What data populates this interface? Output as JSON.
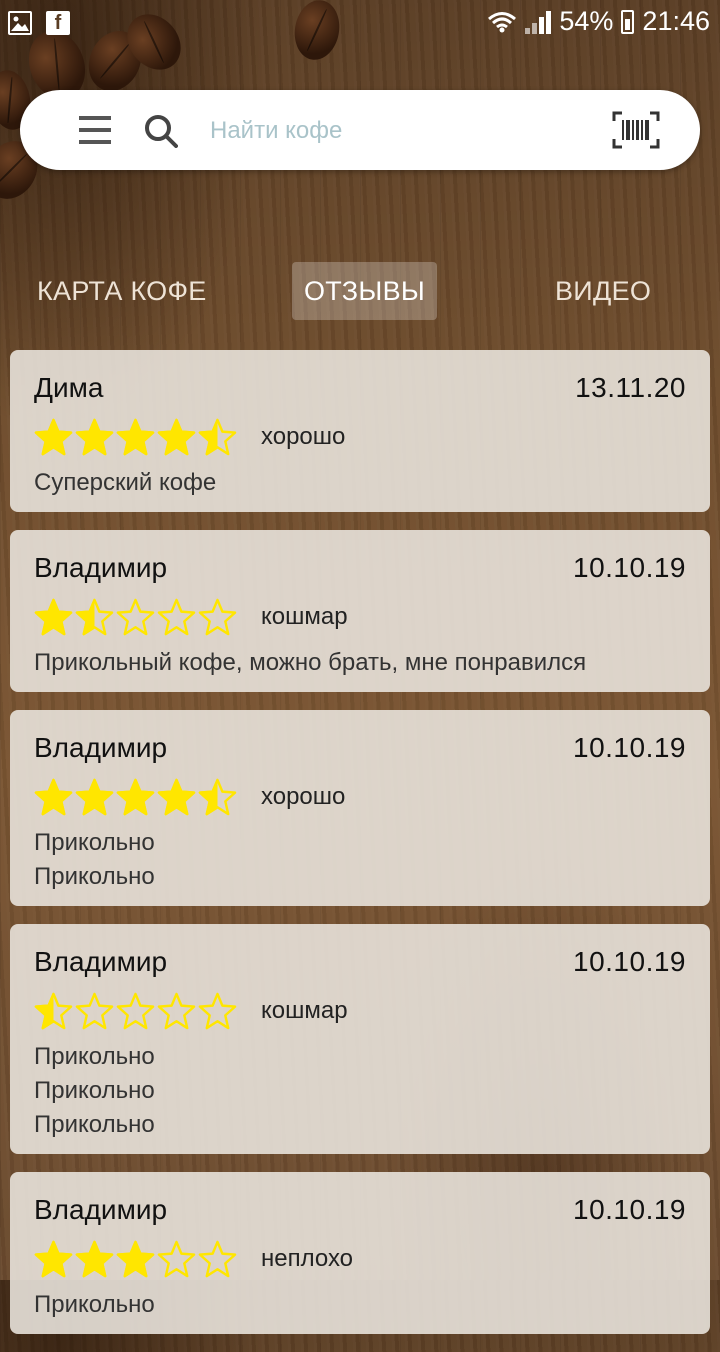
{
  "status_bar": {
    "battery": "54%",
    "time": "21:46"
  },
  "search": {
    "placeholder": "Найти кофе"
  },
  "tabs": [
    {
      "label": "КАРТА КОФЕ"
    },
    {
      "label": "ОТЗЫВЫ"
    },
    {
      "label": "ВИДЕО"
    }
  ],
  "colors": {
    "star_fill": "#ffe600",
    "card_bg": "#e8e2da",
    "placeholder": "#a9c3c9"
  },
  "reviews": [
    {
      "author": "Дима",
      "date": "13.11.20",
      "rating": 4.5,
      "rating_label": "хорошо",
      "comment_lines": [
        "Суперский кофе"
      ]
    },
    {
      "author": "Владимир",
      "date": "10.10.19",
      "rating": 1.5,
      "rating_label": "кошмар",
      "comment_lines": [
        "Прикольный кофе, можно брать, мне понравился"
      ]
    },
    {
      "author": "Владимир",
      "date": "10.10.19",
      "rating": 4.5,
      "rating_label": "хорошо",
      "comment_lines": [
        "Прикольно",
        "Прикольно"
      ]
    },
    {
      "author": "Владимир",
      "date": "10.10.19",
      "rating": 0.5,
      "rating_label": "кошмар",
      "comment_lines": [
        "Прикольно",
        "Прикольно",
        "Прикольно"
      ]
    },
    {
      "author": "Владимир",
      "date": "10.10.19",
      "rating": 3,
      "rating_label": "неплохо",
      "comment_lines": [
        "Прикольно"
      ]
    }
  ]
}
